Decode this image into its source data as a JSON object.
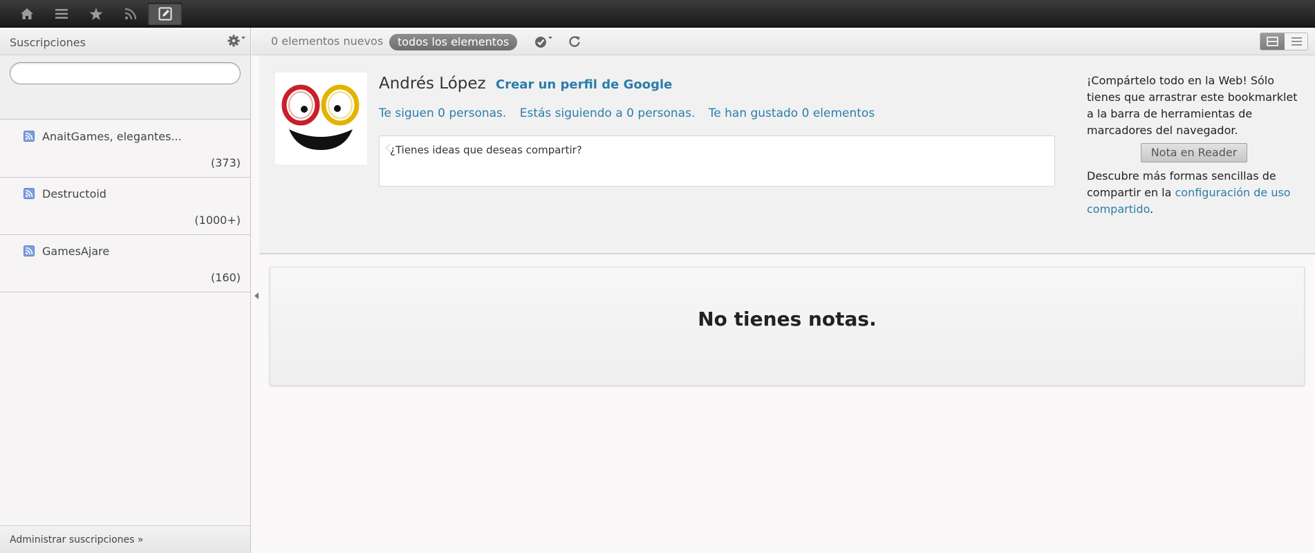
{
  "topbar": {
    "buttons": [
      {
        "icon": "home-icon"
      },
      {
        "icon": "list-icon"
      },
      {
        "icon": "star-icon"
      },
      {
        "icon": "rss-icon"
      },
      {
        "icon": "notes-icon",
        "active": true
      }
    ]
  },
  "sidebar": {
    "title": "Suscripciones",
    "search": {
      "value": "",
      "placeholder": ""
    },
    "feeds": [
      {
        "name": "AnaitGames, elegantes...",
        "count": "(373)",
        "icon": "feed-icon"
      },
      {
        "name": "Destructoid",
        "count": "(1000+)",
        "icon": "feed-icon"
      },
      {
        "name": "GamesAjare",
        "count": "(160)",
        "icon": "feed-icon"
      }
    ],
    "footer": "Administrar suscripciones »"
  },
  "toolbar": {
    "new_items": "0 elementos nuevos",
    "all_items": "todos los elementos"
  },
  "profile": {
    "name": "Andrés López",
    "create_profile": "Crear un perfil de Google",
    "followers": "Te siguen 0 personas.",
    "following": "Estás siguiendo a 0 personas.",
    "liked": "Te han gustado 0 elementos",
    "share_placeholder": "¿Tienes ideas que deseas compartir?"
  },
  "share_info": {
    "text1": "¡Compártelo todo en la Web! Sólo tienes que arrastrar este bookmarklet a la barra de herramientas de marcadores del navegador.",
    "button": "Nota en Reader",
    "text2": "Descubre más formas sencillas de compartir en la ",
    "link": "configuración de uso compartido",
    "text3": "."
  },
  "notes": {
    "empty_message": "No tienes notas."
  },
  "colors": {
    "link": "#2a7dab",
    "topbar": "#1e1e1e",
    "pill": "#7a7a7a"
  }
}
